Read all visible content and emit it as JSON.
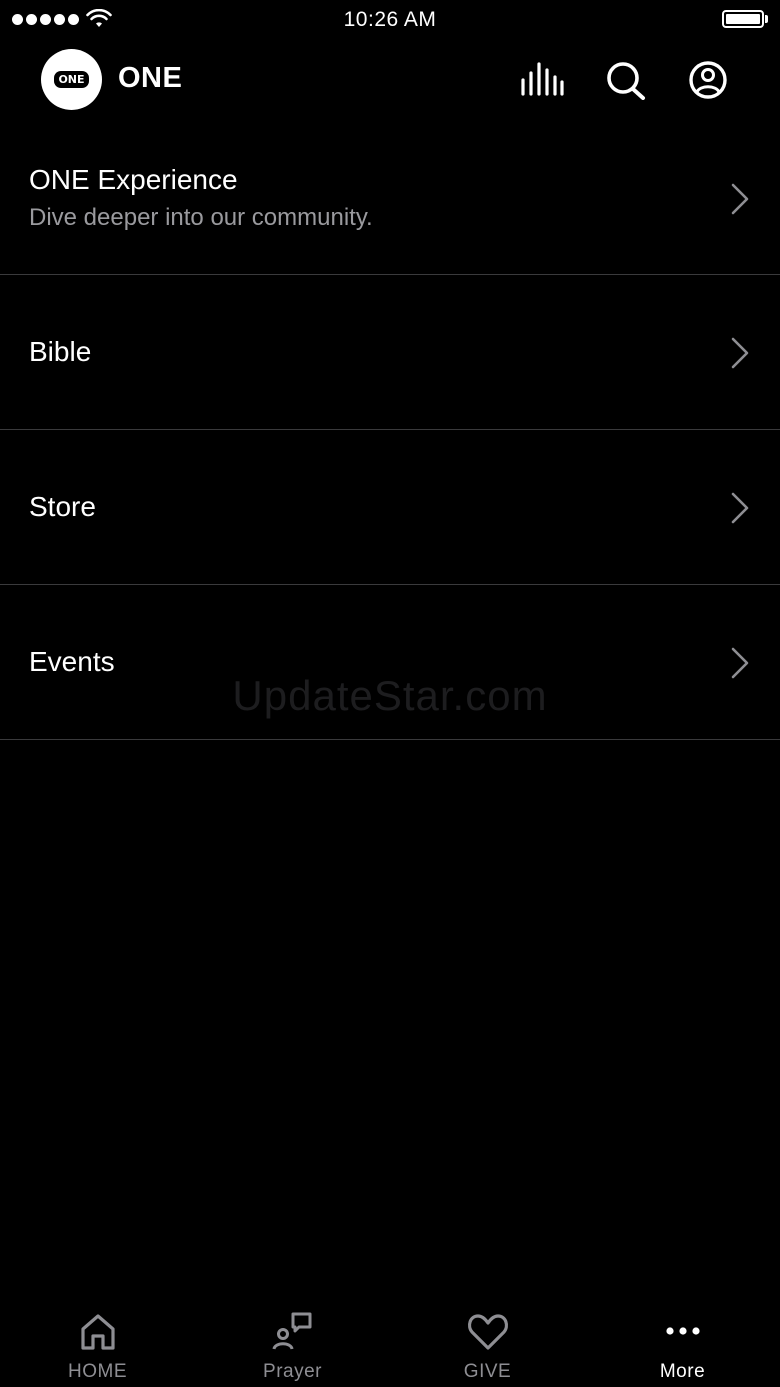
{
  "status_bar": {
    "time": "10:26 AM"
  },
  "header": {
    "logo_text": "ONE",
    "app_name": "ONE",
    "icons": [
      "audio-bars-icon",
      "search-icon",
      "profile-icon"
    ]
  },
  "menu": {
    "items": [
      {
        "title": "ONE Experience",
        "subtitle": "Dive deeper into our community."
      },
      {
        "title": "Bible"
      },
      {
        "title": "Store"
      },
      {
        "title": "Events"
      }
    ]
  },
  "watermark": "UpdateStar.com",
  "tab_bar": {
    "tabs": [
      {
        "label": "HOME",
        "icon": "home-icon",
        "active": false
      },
      {
        "label": "Prayer",
        "icon": "prayer-icon",
        "active": false
      },
      {
        "label": "GIVE",
        "icon": "heart-icon",
        "active": false
      },
      {
        "label": "More",
        "icon": "more-dots-icon",
        "active": true
      }
    ]
  },
  "colors": {
    "background": "#000000",
    "text_primary": "#ffffff",
    "text_secondary": "#9a9a9e",
    "divider": "#3a3a3c",
    "tab_inactive": "#8e8e93"
  }
}
